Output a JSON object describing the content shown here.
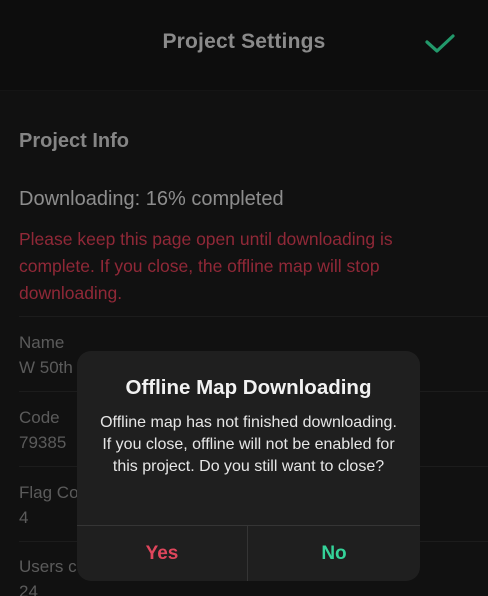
{
  "header": {
    "title": "Project Settings",
    "confirm_icon": "checkmark-icon",
    "accent_color": "#2ecc8f"
  },
  "project_info": {
    "section_title": "Project Info",
    "progress_text": "Downloading: 16% completed",
    "progress_percent": 16,
    "warning_text": "Please keep this page open until downloading is complete. If you close, the offline map will stop downloading.",
    "warning_color": "#c0364a"
  },
  "fields": [
    {
      "label": "Name",
      "value": "W 50th"
    },
    {
      "label": "Code",
      "value": "79385"
    },
    {
      "label": "Flag Co",
      "value": "4"
    },
    {
      "label": "Users c",
      "value": "24"
    }
  ],
  "dialog": {
    "title": "Offline Map Downloading",
    "message": "Offline map has not finished downloading. If you close, offline will not be enabled for this project. Do you still want to close?",
    "yes_label": "Yes",
    "no_label": "No",
    "yes_color": "#e0465c",
    "no_color": "#34d399"
  }
}
